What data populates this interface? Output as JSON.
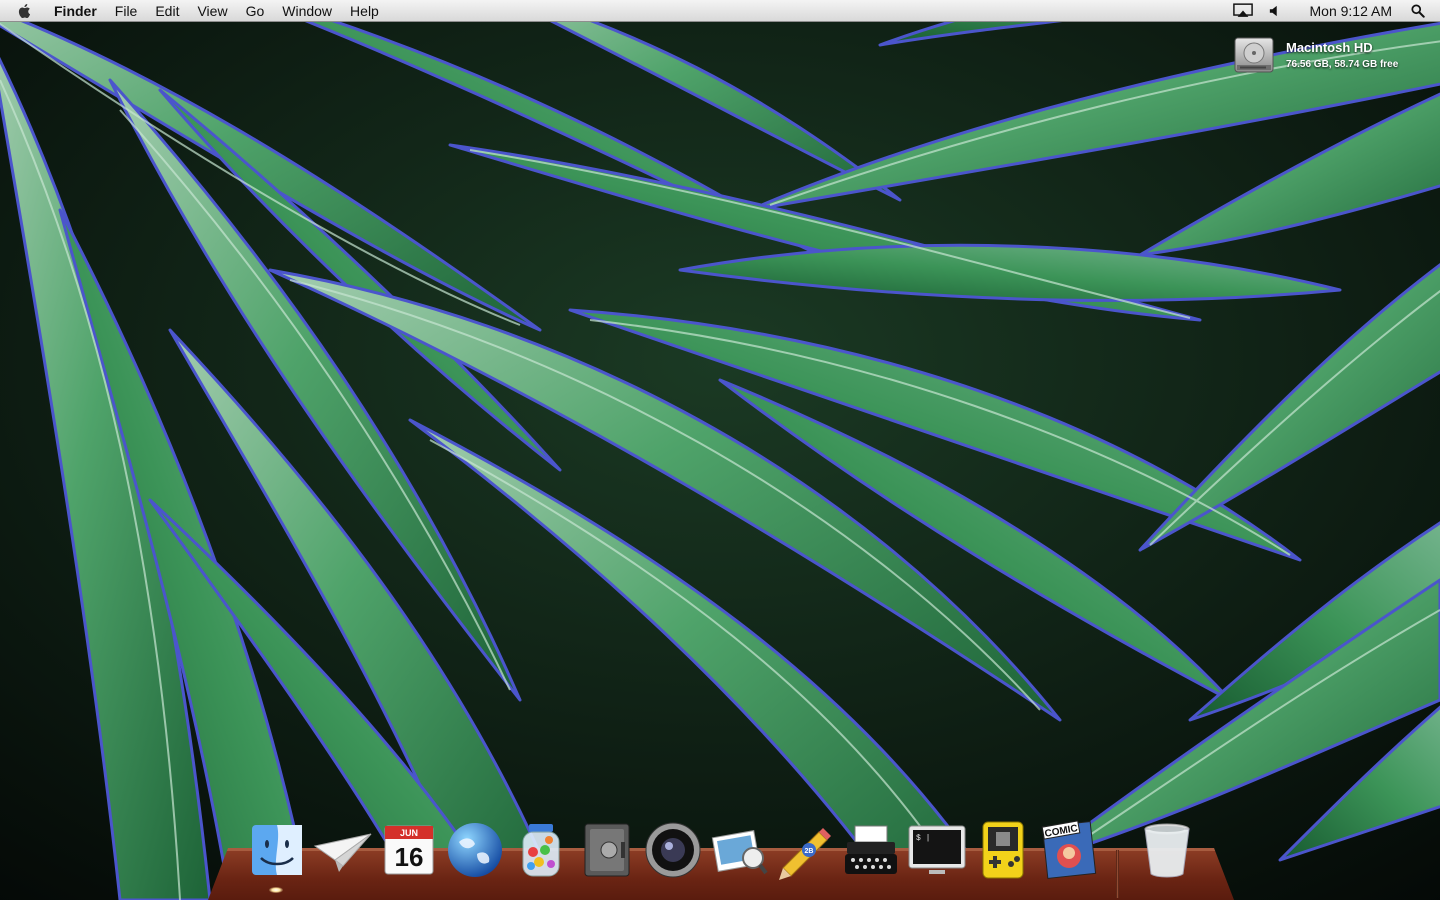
{
  "menubar": {
    "apple_icon": "apple-logo-icon",
    "app_name": "Finder",
    "menus": [
      "File",
      "Edit",
      "View",
      "Go",
      "Window",
      "Help"
    ],
    "status_icons": [
      "airplay-icon",
      "volume-icon",
      "spotlight-search-icon"
    ],
    "clock": "Mon 9:12 AM"
  },
  "desktop": {
    "disk": {
      "icon": "hard-drive-icon",
      "name": "Macintosh HD",
      "info": "76.56 GB, 58.74 GB free"
    }
  },
  "dock": {
    "items": [
      {
        "icon": "finder-icon",
        "running": true
      },
      {
        "icon": "paper-plane-mail-icon",
        "running": false
      },
      {
        "icon": "calendar-icon",
        "month": "JUN",
        "day": "16",
        "running": false
      },
      {
        "icon": "globe-browser-icon",
        "running": false
      },
      {
        "icon": "candy-jar-icon",
        "running": false
      },
      {
        "icon": "safe-vault-icon",
        "running": false
      },
      {
        "icon": "camera-lens-icon",
        "running": false
      },
      {
        "icon": "photo-preview-icon",
        "running": false
      },
      {
        "icon": "pencil-icon",
        "badge": "2B",
        "running": false
      },
      {
        "icon": "typewriter-icon",
        "running": false
      },
      {
        "icon": "terminal-icon",
        "prompt": "$ |",
        "running": false
      },
      {
        "icon": "handheld-game-icon",
        "running": false
      },
      {
        "icon": "comic-book-icon",
        "label": "COMIC",
        "running": false
      },
      {
        "icon": "trash-icon",
        "running": false
      }
    ]
  },
  "colors": {
    "leaf_light": "#8fc2a0",
    "leaf_mid": "#3f9a5c",
    "leaf_dark": "#1f6a3a",
    "leaf_edge": "#4a52c8",
    "dock_wood": "#7a2e18"
  }
}
